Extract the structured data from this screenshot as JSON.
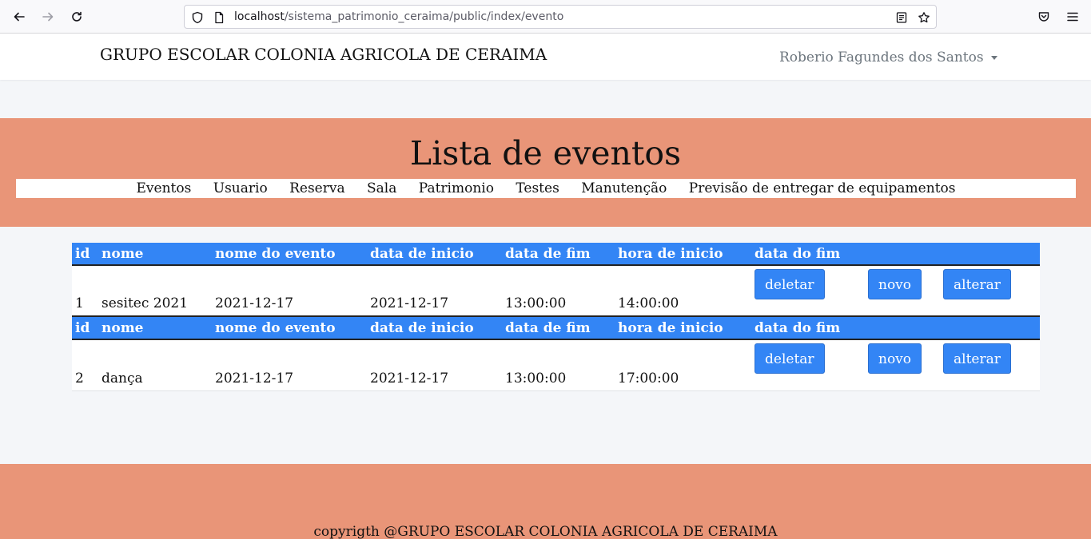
{
  "browser": {
    "url_host": "localhost",
    "url_path": "/sistema_patrimonio_ceraima/public/index/evento",
    "icons": [
      "back-arrow-icon",
      "forward-arrow-icon",
      "reload-icon",
      "shield-icon",
      "page-icon",
      "reader-view-icon",
      "bookmark-star-icon",
      "pocket-icon",
      "hamburger-menu-icon"
    ]
  },
  "header": {
    "brand": "GRUPO ESCOLAR COLONIA AGRICOLA DE CERAIMA",
    "user_name": "Roberio Fagundes dos Santos"
  },
  "banner": {
    "title": "Lista de eventos",
    "menu": [
      "Eventos",
      "Usuario",
      "Reserva",
      "Sala",
      "Patrimonio",
      "Testes",
      "Manutenção",
      "Previsão de entregar de equipamentos"
    ]
  },
  "table": {
    "headers": [
      "id",
      "nome",
      "nome do evento",
      "data de inicio",
      "data de fim",
      "hora de inicio",
      "data do fim"
    ],
    "rows": [
      {
        "cells": [
          "1",
          "sesitec 2021",
          "2021-12-17",
          "2021-12-17",
          "13:00:00",
          "14:00:00"
        ]
      },
      {
        "cells": [
          "2",
          "dança",
          "2021-12-17",
          "2021-12-17",
          "13:00:00",
          "17:00:00"
        ]
      }
    ],
    "buttons": {
      "delete": "deletar",
      "new": "novo",
      "edit": "alterar"
    }
  },
  "footer": {
    "text": "copyrigth @GRUPO ESCOLAR COLONIA AGRICOLA DE CERAIMA"
  },
  "colors": {
    "banner": "#e99578",
    "table_header": "#3385f5",
    "button": "#3385f5",
    "page_bg": "#f4f6f9"
  }
}
